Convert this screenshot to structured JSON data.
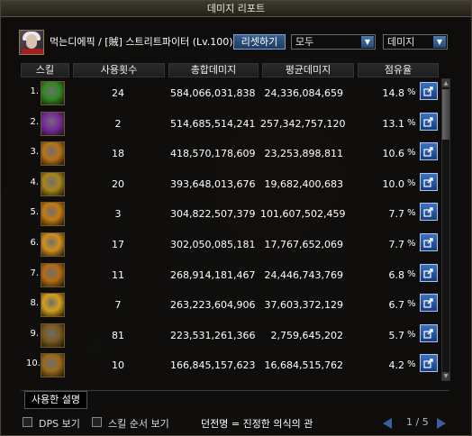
{
  "window": {
    "title": "데미지 리포트"
  },
  "header": {
    "character": "먹는디에픽 / [賊] 스트리트파이터 (Lv.100)",
    "reset_label": "리셋하기",
    "filter_value": "모두",
    "metric_value": "데미지"
  },
  "columns": [
    "스킬",
    "사용횟수",
    "총합데미지",
    "평균데미지",
    "점유율"
  ],
  "rows": [
    {
      "rank": "1.",
      "uses": "24",
      "total": "584,066,031,838",
      "avg": "24,336,084,659",
      "share": "14.8",
      "pct": "%",
      "color": "#2f8a22"
    },
    {
      "rank": "2.",
      "uses": "2",
      "total": "514,685,514,241",
      "avg": "257,342,757,120",
      "share": "13.1",
      "pct": "%",
      "color": "#7a2aa0"
    },
    {
      "rank": "3.",
      "uses": "18",
      "total": "418,570,178,609",
      "avg": "23,253,898,811",
      "share": "10.6",
      "pct": "%",
      "color": "#b8731a"
    },
    {
      "rank": "4.",
      "uses": "20",
      "total": "393,648,013,676",
      "avg": "19,682,400,683",
      "share": "10.0",
      "pct": "%",
      "color": "#a8841a"
    },
    {
      "rank": "5.",
      "uses": "3",
      "total": "304,822,507,379",
      "avg": "101,607,502,459",
      "share": "7.7",
      "pct": "%",
      "color": "#c47a10"
    },
    {
      "rank": "6.",
      "uses": "17",
      "total": "302,050,085,181",
      "avg": "17,767,652,069",
      "share": "7.7",
      "pct": "%",
      "color": "#d0901a"
    },
    {
      "rank": "7.",
      "uses": "11",
      "total": "268,914,181,467",
      "avg": "24,446,743,769",
      "share": "6.8",
      "pct": "%",
      "color": "#b56b12"
    },
    {
      "rank": "8.",
      "uses": "7",
      "total": "263,223,604,906",
      "avg": "37,603,372,129",
      "share": "6.7",
      "pct": "%",
      "color": "#d4a01a"
    },
    {
      "rank": "9.",
      "uses": "81",
      "total": "223,531,261,366",
      "avg": "2,759,645,202",
      "share": "5.7",
      "pct": "%",
      "color": "#7a5a20"
    },
    {
      "rank": "10.",
      "uses": "10",
      "total": "166,845,157,623",
      "avg": "16,684,515,762",
      "share": "4.2",
      "pct": "%",
      "color": "#9a6a1a"
    }
  ],
  "tab_label": "사용한 설명",
  "footer": {
    "dps_label": "DPS 보기",
    "order_label": "스킬 순서 보기",
    "title_tag": "던전명 = 진정한 의식의 관",
    "page": "1 / 5"
  },
  "icons": {
    "share": "share-out-icon",
    "portrait": "character-portrait"
  }
}
